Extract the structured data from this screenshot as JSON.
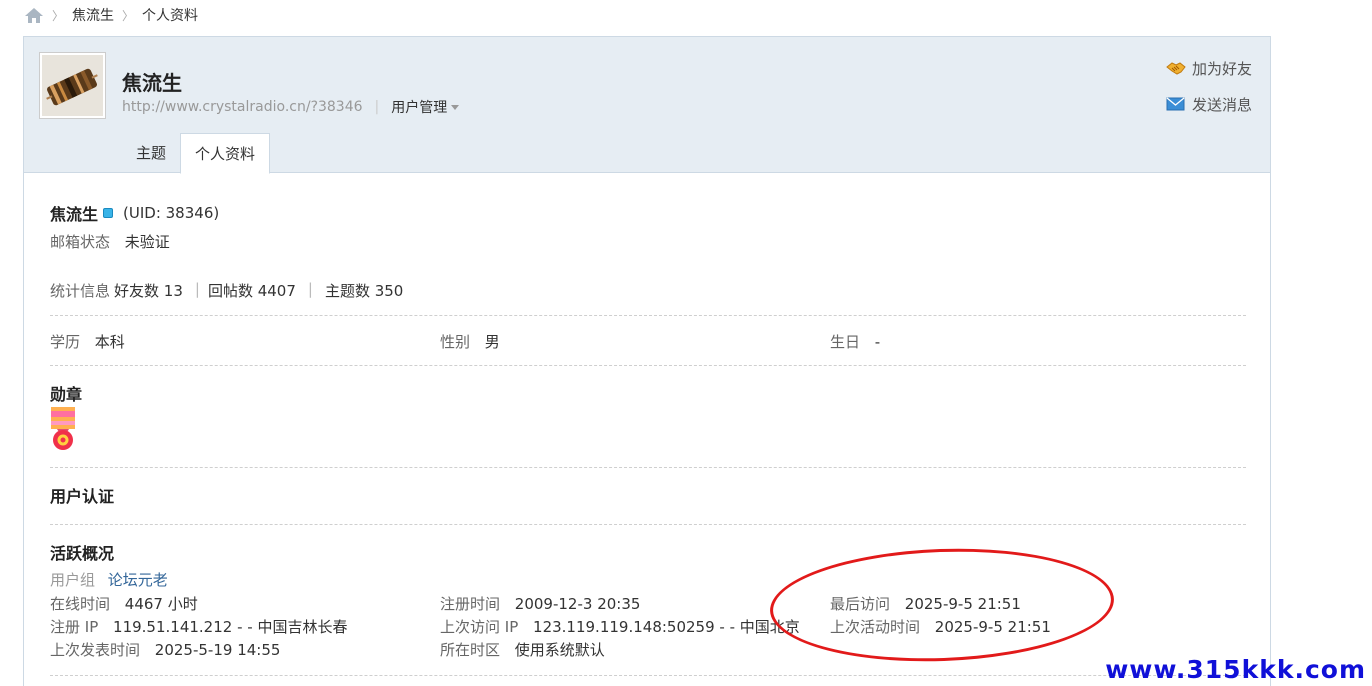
{
  "breadcrumb": {
    "items": [
      "焦流生",
      "个人资料"
    ]
  },
  "profile": {
    "name": "焦流生",
    "url": "http://www.crystalradio.cn/?38346",
    "manage_label": "用户管理",
    "add_friend": "加为好友",
    "send_message": "发送消息"
  },
  "tabs": [
    {
      "label": "主题",
      "active": false
    },
    {
      "label": "个人资料",
      "active": true
    }
  ],
  "info": {
    "name": "焦流生",
    "uid": "(UID: 38346)",
    "email_status_label": "邮箱状态",
    "email_status_value": "未验证",
    "stats_label": "统计信息",
    "friends": "好友数 13",
    "replies": "回帖数 4407",
    "threads": "主题数 350",
    "education_label": "学历",
    "education_value": "本科",
    "gender_label": "性别",
    "gender_value": "男",
    "birthday_label": "生日",
    "birthday_value": "-"
  },
  "sections": {
    "medals": "勋章",
    "verification": "用户认证",
    "activity": "活跃概况"
  },
  "activity": {
    "group_label": "用户组",
    "group_value": "论坛元老",
    "online_label": "在线时间",
    "online_value": "4467 小时",
    "reg_time_label": "注册时间",
    "reg_time_value": "2009-12-3 20:35",
    "last_visit_label": "最后访问",
    "last_visit_value": "2025-9-5 21:51",
    "reg_ip_label": "注册 IP",
    "reg_ip_value": "119.51.141.212 - - 中国吉林长春",
    "last_ip_label": "上次访问 IP",
    "last_ip_value": "123.119.119.148:50259 - - 中国北京",
    "last_active_label": "上次活动时间",
    "last_active_value": "2025-9-5 21:51",
    "last_post_label": "上次发表时间",
    "last_post_value": "2025-5-19 14:55",
    "timezone_label": "所在时区",
    "timezone_value": "使用系统默认"
  },
  "watermark": "www.315kkk.com",
  "colors": {
    "header_bg": "#e6edf3",
    "link": "#336699",
    "annotation": "#e21a1a",
    "watermark": "#1010d8"
  }
}
